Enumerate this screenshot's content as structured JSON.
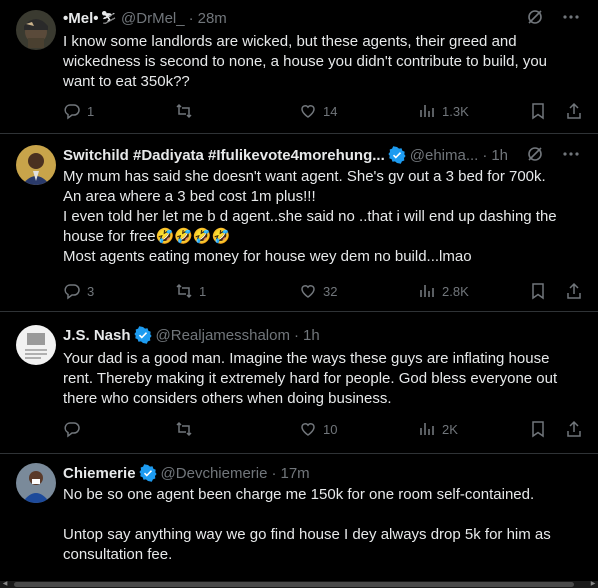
{
  "tweets": [
    {
      "name": "•Mel•",
      "name_emoji": "⛷",
      "verified": false,
      "handle": "@DrMel_",
      "time": "28m",
      "lines": [
        "I know some landlords are wicked, but these agents, their greed and",
        "wickedness is second to none, a house you didn't contribute to build, you",
        "want to eat 350k??"
      ],
      "replies": "1",
      "retweets": "",
      "likes": "14",
      "views": "1.3K"
    },
    {
      "name": "Switchild #Dadiyata #Ifulikevote4morehung...",
      "verified": true,
      "handle": "@ehima...",
      "time": "1h",
      "lines": [
        "My mum has said she doesn't want agent.  She's gv out a 3 bed for 700k.",
        "An area where a 3 bed cost 1m plus!!!",
        "I even told her let me b d agent..she said no ..that i will end up dashing the",
        "house for free🤣🤣🤣🤣",
        "Most agents eating money for house wey dem no build...lmao"
      ],
      "replies": "3",
      "retweets": "1",
      "likes": "32",
      "views": "2.8K"
    },
    {
      "name": "J.S. Nash",
      "verified": true,
      "handle": "@Realjamesshalom",
      "time": "1h",
      "lines": [
        "Your dad is a good man. Imagine the ways these guys are inflating house",
        "rent. Thereby making it extremely hard for people. God bless everyone out",
        "there who considers others when doing business."
      ],
      "replies": "",
      "retweets": "",
      "likes": "10",
      "views": "2K"
    },
    {
      "name": "Chiemerie",
      "verified": true,
      "handle": "@Devchiemerie",
      "time": "17m",
      "lines": [
        "No be so one agent been charge  me 150k for one room self-contained.",
        "",
        "Untop say anything way we go find house I dey always drop 5k for him as",
        "consultation fee."
      ]
    }
  ],
  "colors": {
    "background": "#000000",
    "text": "#e7e9ea",
    "muted": "#71767b",
    "verified": "#1d9bf0",
    "divider": "#2f3336"
  }
}
